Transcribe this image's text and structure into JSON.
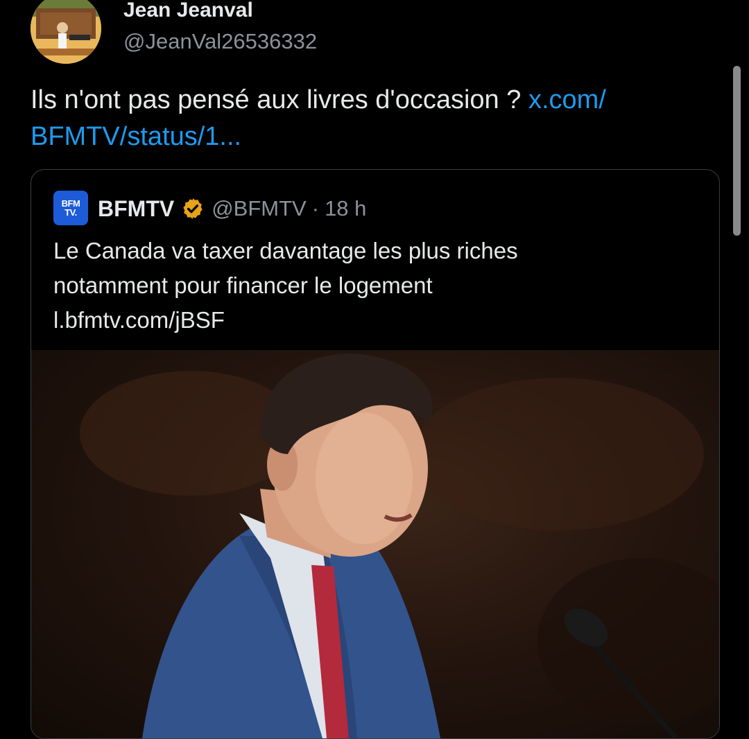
{
  "post": {
    "author_name": "Jean Jeanval",
    "author_handle": "@JeanVal26536332",
    "text": "Ils n'ont pas pensé aux livres d'occasion ?",
    "link_line1": "x.com/",
    "link_line2": "BFMTV/status/1..."
  },
  "quoted": {
    "logo_line1": "BFM",
    "logo_line2": "TV.",
    "name": "BFMTV",
    "verified_icon": "verified-badge-icon",
    "handle": "@BFMTV",
    "separator": "·",
    "time": "18 h",
    "text_line1": "Le Canada va taxer davantage les plus riches",
    "text_line2": "notamment pour financer le logement",
    "text_line3": "l.bfmtv.com/jBSF"
  },
  "colors": {
    "background": "#000000",
    "link": "#1d9bf0",
    "secondary_text": "#8b9399",
    "badge": "#e8a317",
    "logo": "#1d5bd8"
  }
}
